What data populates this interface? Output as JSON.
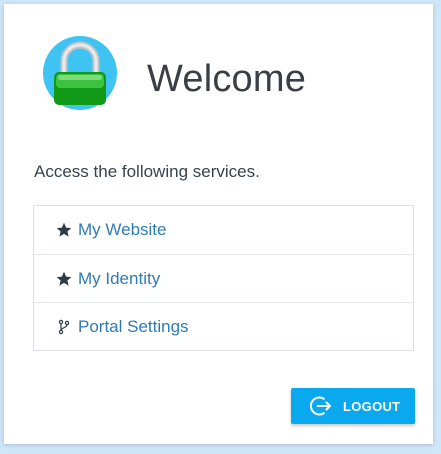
{
  "header": {
    "logo_icon": "padlock-icon",
    "title": "Welcome"
  },
  "intro": {
    "text": "Access the following services."
  },
  "services": [
    {
      "icon": "star-icon",
      "label": "My Website"
    },
    {
      "icon": "star-icon",
      "label": "My Identity"
    },
    {
      "icon": "branch-icon",
      "label": "Portal Settings"
    }
  ],
  "actions": {
    "logout_label": "LOGOUT",
    "logout_icon": "logout-icon"
  },
  "colors": {
    "accent": "#0aa8ef",
    "link": "#2f7bb5",
    "background": "#cfe6f8",
    "lock_body": "#17a51d",
    "lock_badge": "#3fc3f2"
  }
}
